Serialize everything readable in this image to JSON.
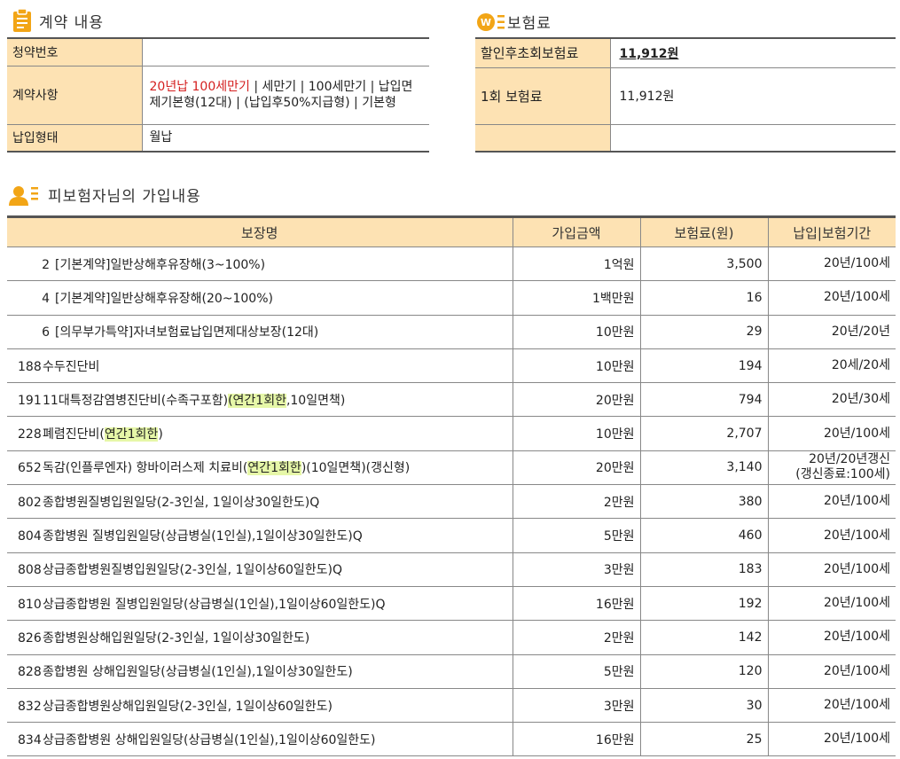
{
  "contract": {
    "title": "계약 내용",
    "rows": [
      {
        "label": "청약번호",
        "value": ""
      },
      {
        "label": "계약사항",
        "highlight": "20년납 100세만기",
        "value": " | 세만기 | 100세만기 | 납입면제기본형(12대) | (납입후50%지급형) | 기본형"
      },
      {
        "label": "납입형태",
        "value": "월납"
      }
    ]
  },
  "premium": {
    "title": "보험료",
    "rows": [
      {
        "label": "할인후초회보험료",
        "value": "11,912원"
      },
      {
        "label": "1회 보험료",
        "value": "11,912원"
      },
      {
        "label": "",
        "value": ""
      }
    ]
  },
  "insured": {
    "title": "피보험자님의 가입내용",
    "headers": [
      "보장명",
      "가입금액",
      "보험료(원)",
      "납입|보험기간"
    ],
    "rows": [
      {
        "no": "2",
        "name": "[기본계약]일반상해후유장해(3~100%)",
        "amount": "1억원",
        "premium": "3,500",
        "term": "20년/100세"
      },
      {
        "no": "4",
        "name": "[기본계약]일반상해후유장해(20~100%)",
        "amount": "1백만원",
        "premium": "16",
        "term": "20년/100세"
      },
      {
        "no": "6",
        "name": "[의무부가특약]자녀보험료납입면제대상보장(12대)",
        "amount": "10만원",
        "premium": "29",
        "term": "20년/20년"
      },
      {
        "no": "188",
        "name": "수두진단비",
        "amount": "10만원",
        "premium": "194",
        "term": "20세/20세"
      },
      {
        "no": "191",
        "name": "11대특정감염병진단비(수족구포함)",
        "hl": "(연간1회한",
        "suffix": ",10일면책)",
        "amount": "20만원",
        "premium": "794",
        "term": "20년/30세"
      },
      {
        "no": "228",
        "name": "폐렴진단비(",
        "hl": "연간1회한",
        "suffix": ")",
        "amount": "10만원",
        "premium": "2,707",
        "term": "20년/100세"
      },
      {
        "no": "652",
        "name": "독감(인플루엔자) 항바이러스제 치료비(",
        "hl": "연간1회한",
        "suffix": ")(10일면책)(갱신형)",
        "amount": "20만원",
        "premium": "3,140",
        "term": "20년/20년갱신",
        "term2": "(갱신종료:100세)"
      },
      {
        "no": "802",
        "name": "종합병원질병입원일당(2-3인실, 1일이상30일한도)Q",
        "amount": "2만원",
        "premium": "380",
        "term": "20년/100세"
      },
      {
        "no": "804",
        "name": "종합병원 질병입원일당(상급병실(1인실),1일이상30일한도)Q",
        "amount": "5만원",
        "premium": "460",
        "term": "20년/100세"
      },
      {
        "no": "808",
        "name": "상급종합병원질병입원일당(2-3인실, 1일이상60일한도)Q",
        "amount": "3만원",
        "premium": "183",
        "term": "20년/100세"
      },
      {
        "no": "810",
        "name": "상급종합병원 질병입원일당(상급병실(1인실),1일이상60일한도)Q",
        "amount": "16만원",
        "premium": "192",
        "term": "20년/100세"
      },
      {
        "no": "826",
        "name": "종합병원상해입원일당(2-3인실, 1일이상30일한도)",
        "amount": "2만원",
        "premium": "142",
        "term": "20년/100세"
      },
      {
        "no": "828",
        "name": "종합병원 상해입원일당(상급병실(1인실),1일이상30일한도)",
        "amount": "5만원",
        "premium": "120",
        "term": "20년/100세"
      },
      {
        "no": "832",
        "name": "상급종합병원상해입원일당(2-3인실, 1일이상60일한도)",
        "amount": "3만원",
        "premium": "30",
        "term": "20년/100세"
      },
      {
        "no": "834",
        "name": "상급종합병원 상해입원일당(상급병실(1인실),1일이상60일한도)",
        "amount": "16만원",
        "premium": "25",
        "term": "20년/100세"
      }
    ]
  },
  "icons": {
    "contract": "clipboard-icon",
    "premium": "won-list-icon",
    "insured": "person-list-icon"
  },
  "colors": {
    "accent": "#f2a516",
    "label_bg": "#fde2b3",
    "highlight": "#e6f7a8",
    "red": "#d41f1f"
  }
}
